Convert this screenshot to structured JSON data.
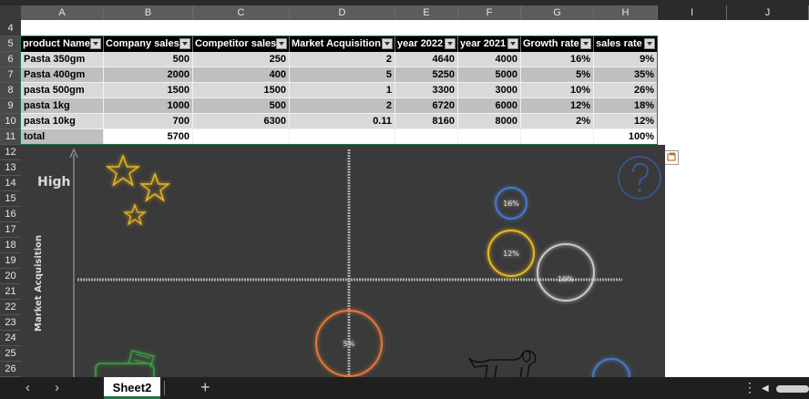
{
  "sheet": {
    "columns": [
      "A",
      "B",
      "C",
      "D",
      "E",
      "F",
      "G",
      "H",
      "I",
      "J"
    ],
    "rows": [
      "4",
      "5",
      "6",
      "7",
      "8",
      "9",
      "10",
      "11",
      "12",
      "13",
      "14",
      "15",
      "16",
      "17",
      "18",
      "19",
      "20",
      "21",
      "22",
      "23",
      "24",
      "25",
      "26"
    ],
    "table": {
      "headers": [
        "product Name",
        "Company sales",
        "Competitor sales",
        "Market Acquisition",
        "year 2022",
        "year 2021",
        "Growth rate",
        "sales rate"
      ],
      "rows": [
        [
          "Pasta 350gm",
          "500",
          "250",
          "2",
          "4640",
          "4000",
          "16%",
          "9%"
        ],
        [
          "Pasta 400gm",
          "2000",
          "400",
          "5",
          "5250",
          "5000",
          "5%",
          "35%"
        ],
        [
          "pasta 500gm",
          "1500",
          "1500",
          "1",
          "3300",
          "3000",
          "10%",
          "26%"
        ],
        [
          "pasta 1kg",
          "1000",
          "500",
          "2",
          "6720",
          "6000",
          "12%",
          "18%"
        ],
        [
          "pasta 10kg",
          "700",
          "6300",
          "0.11",
          "8160",
          "8000",
          "2%",
          "12%"
        ]
      ],
      "total": [
        "total",
        "5700",
        "",
        "",
        "",
        "",
        "",
        "100%"
      ]
    }
  },
  "chart": {
    "high_label": "High",
    "y_axis_label": "Market Acquisition",
    "bubble_labels": [
      "16%",
      "12%",
      "10%",
      "5%"
    ],
    "colors": {
      "background": "#3a3a3a",
      "stars": "#e8b820",
      "bubble_16": "#4a78c8",
      "bubble_12": "#e8b820",
      "bubble_10": "#c8c8c8",
      "bubble_5": "#e07838",
      "question": "#3a5a9a",
      "axis": "#9a9a9a"
    },
    "icons": [
      "star-icon",
      "question-mark-icon",
      "dog-icon",
      "cash-icon"
    ]
  },
  "tabs": {
    "active": "Sheet2",
    "add": "+"
  }
}
